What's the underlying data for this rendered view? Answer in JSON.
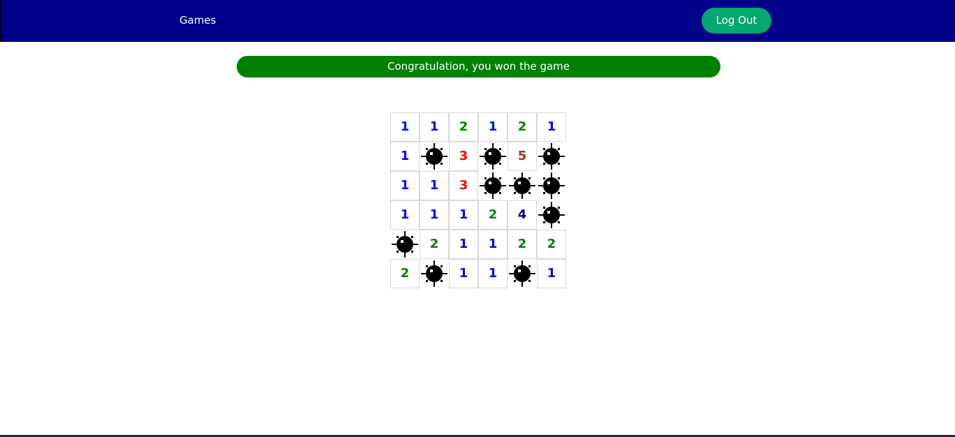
{
  "nav": {
    "games_label": "Games",
    "logout_label": "Log Out"
  },
  "status": {
    "message": "Congratulation, you won the game"
  },
  "colors": {
    "nav_bg": "#00008b",
    "logout_bg": "#04a86f",
    "banner_bg": "#008000",
    "number_colors": {
      "1": "#0000ff",
      "2": "#008000",
      "3": "#ff0000",
      "4": "#000080",
      "5": "#a52a2a"
    }
  },
  "board": {
    "rows": 6,
    "cols": 6,
    "cells": [
      [
        "1",
        "1",
        "2",
        "1",
        "2",
        "1"
      ],
      [
        "1",
        "*",
        "3",
        "*",
        "5",
        "*"
      ],
      [
        "1",
        "1",
        "3",
        "*",
        "*",
        "*"
      ],
      [
        "1",
        "1",
        "1",
        "2",
        "4",
        "*"
      ],
      [
        "*",
        "2",
        "1",
        "1",
        "2",
        "2"
      ],
      [
        "2",
        "*",
        "1",
        "1",
        "*",
        "1"
      ]
    ],
    "mine_icon": "mine-icon"
  }
}
